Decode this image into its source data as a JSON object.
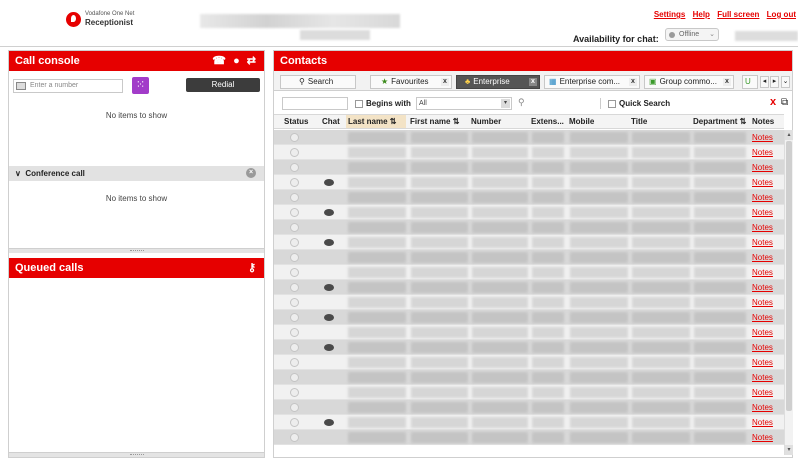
{
  "header": {
    "brand_line1": "Vodafone One Net",
    "brand_line2": "Receptionist",
    "links": [
      "Settings",
      "Help",
      "Full screen",
      "Log out"
    ],
    "availability_label": "Availability for chat:",
    "availability_value": "Offline"
  },
  "call_console": {
    "title": "Call console",
    "number_placeholder": "Enter a number",
    "redial_label": "Redial",
    "no_items": "No items to show",
    "conference_title": "Conference call",
    "conference_no_items": "No items to show"
  },
  "queued_calls": {
    "title": "Queued calls"
  },
  "contacts": {
    "title": "Contacts",
    "tabs": [
      {
        "label": "Search",
        "icon": "search-icon"
      },
      {
        "label": "Favourites",
        "icon": "star-icon",
        "closable": true
      },
      {
        "label": "Enterprise",
        "icon": "people-icon",
        "closable": true,
        "active": true
      },
      {
        "label": "Enterprise com...",
        "icon": "directory-icon",
        "closable": true
      },
      {
        "label": "Group commo...",
        "icon": "group-icon",
        "closable": true
      }
    ],
    "begins_with_label": "Begins with",
    "filter_select": "All",
    "quick_search_label": "Quick Search",
    "columns": [
      "Status",
      "Chat",
      "Last name",
      "First name",
      "Number",
      "Extens...",
      "Mobile",
      "Title",
      "Department",
      "Notes"
    ],
    "notes_link": "Notes",
    "rows": [
      {
        "chat": false
      },
      {
        "chat": false
      },
      {
        "chat": false
      },
      {
        "chat": true
      },
      {
        "chat": false
      },
      {
        "chat": true
      },
      {
        "chat": false
      },
      {
        "chat": true
      },
      {
        "chat": false
      },
      {
        "chat": false
      },
      {
        "chat": true
      },
      {
        "chat": false
      },
      {
        "chat": true
      },
      {
        "chat": false
      },
      {
        "chat": true
      },
      {
        "chat": false
      },
      {
        "chat": false
      },
      {
        "chat": false
      },
      {
        "chat": false
      },
      {
        "chat": true
      },
      {
        "chat": false
      }
    ]
  },
  "colors": {
    "brand_red": "#e60000",
    "row_odd": "#d8d8d8",
    "row_even": "#f1f1f1",
    "keypad_purple": "#a23cc9"
  }
}
